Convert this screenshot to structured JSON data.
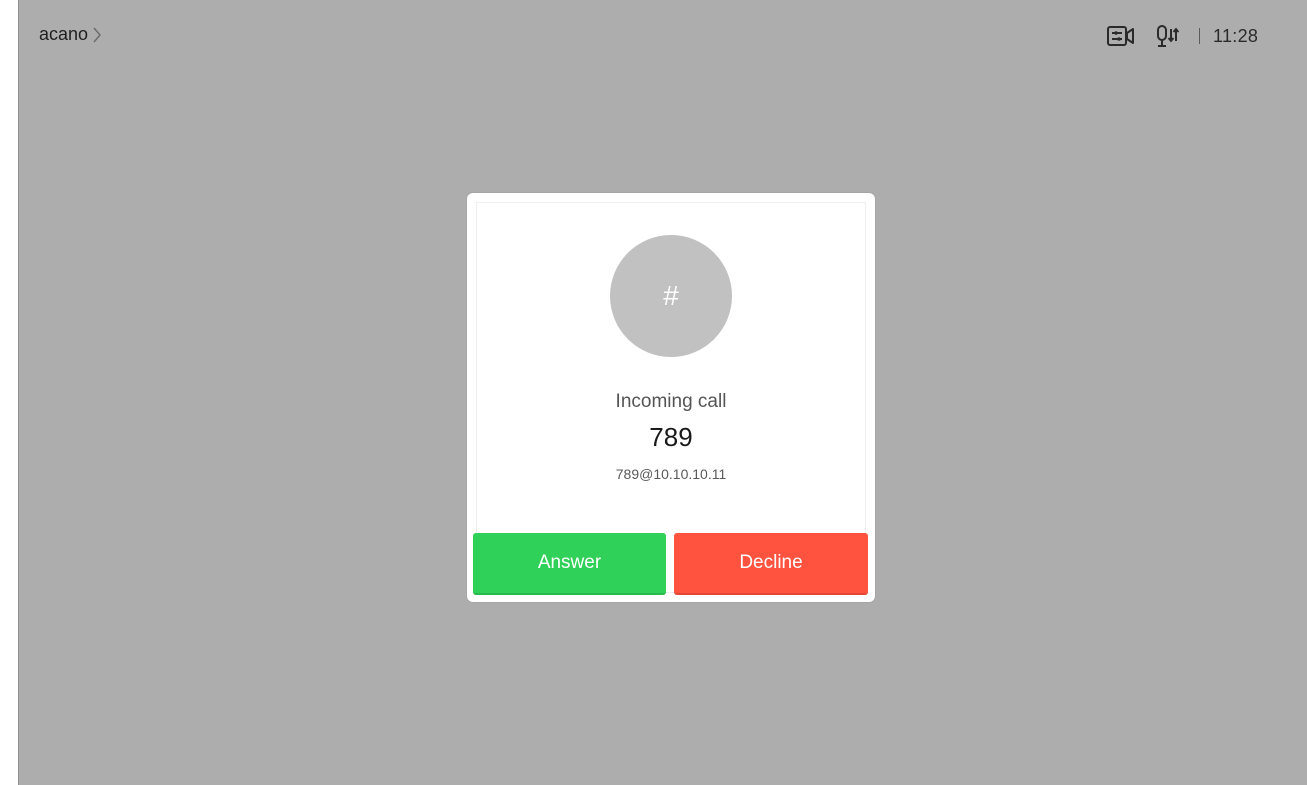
{
  "header": {
    "title": "acano",
    "icons": {
      "breadcrumb": "chevron-right-icon",
      "camera": "camera-controls-icon",
      "mic": "mic-controls-icon"
    },
    "time": "11:28"
  },
  "call_dialog": {
    "avatar_glyph": "#",
    "status": "Incoming call",
    "caller_name": "789",
    "caller_uri": "789@10.10.10.11",
    "answer_label": "Answer",
    "decline_label": "Decline"
  },
  "colors": {
    "background": "#adadad",
    "answer": "#30d158",
    "decline": "#ff5340",
    "avatar": "#c1c1c1"
  }
}
